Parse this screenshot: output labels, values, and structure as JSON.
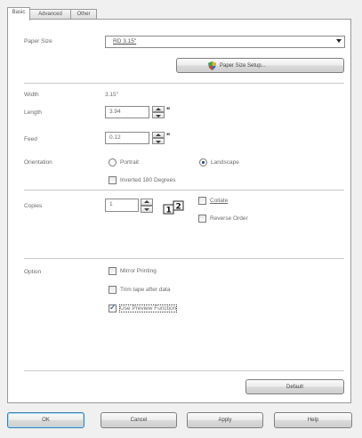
{
  "tabs": [
    "Basic",
    "Advanced",
    "Other"
  ],
  "paper_size": {
    "label": "Paper Size",
    "value": "RD 3.15\"",
    "setup_button": "Paper Size Setup..."
  },
  "width": {
    "label": "Width",
    "value": "3.15\""
  },
  "length": {
    "label": "Length",
    "value": "3.94",
    "unit": "\""
  },
  "feed": {
    "label": "Feed",
    "value": "0.12",
    "unit": "\""
  },
  "orientation": {
    "label": "Orientation",
    "options": [
      "Portrait",
      "Landscape"
    ],
    "selected": "Landscape",
    "inverted_label": "Inverted 180 Degrees",
    "inverted_checked": false
  },
  "copies": {
    "label": "Copies",
    "value": "1",
    "collate_label": "Collate",
    "collate_checked": false,
    "reverse_label": "Reverse Order",
    "reverse_checked": false,
    "collate_icon": "collate-pages-icon"
  },
  "option": {
    "label": "Option",
    "mirror_label": "Mirror Printing",
    "mirror_checked": false,
    "trim_label": "Trim tape after data",
    "trim_checked": false,
    "preview_label": "Use Preview Function",
    "preview_checked": true
  },
  "default_button": "Default",
  "footer": {
    "ok": "OK",
    "cancel": "Cancel",
    "apply": "Apply",
    "help": "Help"
  },
  "colors": {
    "focus_border": "#3c7fb1",
    "panel": "#ffffff",
    "dialog": "#f0f0f0"
  }
}
